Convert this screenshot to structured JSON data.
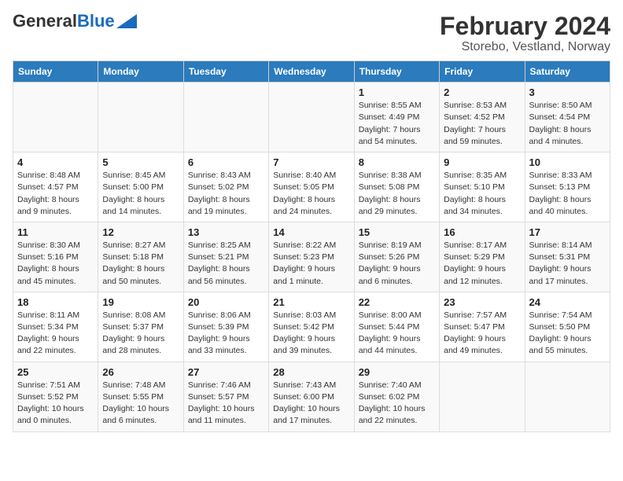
{
  "header": {
    "logo_general": "General",
    "logo_blue": "Blue",
    "title": "February 2024",
    "subtitle": "Storebo, Vestland, Norway"
  },
  "weekdays": [
    "Sunday",
    "Monday",
    "Tuesday",
    "Wednesday",
    "Thursday",
    "Friday",
    "Saturday"
  ],
  "weeks": [
    [
      {
        "day": "",
        "info": ""
      },
      {
        "day": "",
        "info": ""
      },
      {
        "day": "",
        "info": ""
      },
      {
        "day": "",
        "info": ""
      },
      {
        "day": "1",
        "info": "Sunrise: 8:55 AM\nSunset: 4:49 PM\nDaylight: 7 hours\nand 54 minutes."
      },
      {
        "day": "2",
        "info": "Sunrise: 8:53 AM\nSunset: 4:52 PM\nDaylight: 7 hours\nand 59 minutes."
      },
      {
        "day": "3",
        "info": "Sunrise: 8:50 AM\nSunset: 4:54 PM\nDaylight: 8 hours\nand 4 minutes."
      }
    ],
    [
      {
        "day": "4",
        "info": "Sunrise: 8:48 AM\nSunset: 4:57 PM\nDaylight: 8 hours\nand 9 minutes."
      },
      {
        "day": "5",
        "info": "Sunrise: 8:45 AM\nSunset: 5:00 PM\nDaylight: 8 hours\nand 14 minutes."
      },
      {
        "day": "6",
        "info": "Sunrise: 8:43 AM\nSunset: 5:02 PM\nDaylight: 8 hours\nand 19 minutes."
      },
      {
        "day": "7",
        "info": "Sunrise: 8:40 AM\nSunset: 5:05 PM\nDaylight: 8 hours\nand 24 minutes."
      },
      {
        "day": "8",
        "info": "Sunrise: 8:38 AM\nSunset: 5:08 PM\nDaylight: 8 hours\nand 29 minutes."
      },
      {
        "day": "9",
        "info": "Sunrise: 8:35 AM\nSunset: 5:10 PM\nDaylight: 8 hours\nand 34 minutes."
      },
      {
        "day": "10",
        "info": "Sunrise: 8:33 AM\nSunset: 5:13 PM\nDaylight: 8 hours\nand 40 minutes."
      }
    ],
    [
      {
        "day": "11",
        "info": "Sunrise: 8:30 AM\nSunset: 5:16 PM\nDaylight: 8 hours\nand 45 minutes."
      },
      {
        "day": "12",
        "info": "Sunrise: 8:27 AM\nSunset: 5:18 PM\nDaylight: 8 hours\nand 50 minutes."
      },
      {
        "day": "13",
        "info": "Sunrise: 8:25 AM\nSunset: 5:21 PM\nDaylight: 8 hours\nand 56 minutes."
      },
      {
        "day": "14",
        "info": "Sunrise: 8:22 AM\nSunset: 5:23 PM\nDaylight: 9 hours\nand 1 minute."
      },
      {
        "day": "15",
        "info": "Sunrise: 8:19 AM\nSunset: 5:26 PM\nDaylight: 9 hours\nand 6 minutes."
      },
      {
        "day": "16",
        "info": "Sunrise: 8:17 AM\nSunset: 5:29 PM\nDaylight: 9 hours\nand 12 minutes."
      },
      {
        "day": "17",
        "info": "Sunrise: 8:14 AM\nSunset: 5:31 PM\nDaylight: 9 hours\nand 17 minutes."
      }
    ],
    [
      {
        "day": "18",
        "info": "Sunrise: 8:11 AM\nSunset: 5:34 PM\nDaylight: 9 hours\nand 22 minutes."
      },
      {
        "day": "19",
        "info": "Sunrise: 8:08 AM\nSunset: 5:37 PM\nDaylight: 9 hours\nand 28 minutes."
      },
      {
        "day": "20",
        "info": "Sunrise: 8:06 AM\nSunset: 5:39 PM\nDaylight: 9 hours\nand 33 minutes."
      },
      {
        "day": "21",
        "info": "Sunrise: 8:03 AM\nSunset: 5:42 PM\nDaylight: 9 hours\nand 39 minutes."
      },
      {
        "day": "22",
        "info": "Sunrise: 8:00 AM\nSunset: 5:44 PM\nDaylight: 9 hours\nand 44 minutes."
      },
      {
        "day": "23",
        "info": "Sunrise: 7:57 AM\nSunset: 5:47 PM\nDaylight: 9 hours\nand 49 minutes."
      },
      {
        "day": "24",
        "info": "Sunrise: 7:54 AM\nSunset: 5:50 PM\nDaylight: 9 hours\nand 55 minutes."
      }
    ],
    [
      {
        "day": "25",
        "info": "Sunrise: 7:51 AM\nSunset: 5:52 PM\nDaylight: 10 hours\nand 0 minutes."
      },
      {
        "day": "26",
        "info": "Sunrise: 7:48 AM\nSunset: 5:55 PM\nDaylight: 10 hours\nand 6 minutes."
      },
      {
        "day": "27",
        "info": "Sunrise: 7:46 AM\nSunset: 5:57 PM\nDaylight: 10 hours\nand 11 minutes."
      },
      {
        "day": "28",
        "info": "Sunrise: 7:43 AM\nSunset: 6:00 PM\nDaylight: 10 hours\nand 17 minutes."
      },
      {
        "day": "29",
        "info": "Sunrise: 7:40 AM\nSunset: 6:02 PM\nDaylight: 10 hours\nand 22 minutes."
      },
      {
        "day": "",
        "info": ""
      },
      {
        "day": "",
        "info": ""
      }
    ]
  ]
}
